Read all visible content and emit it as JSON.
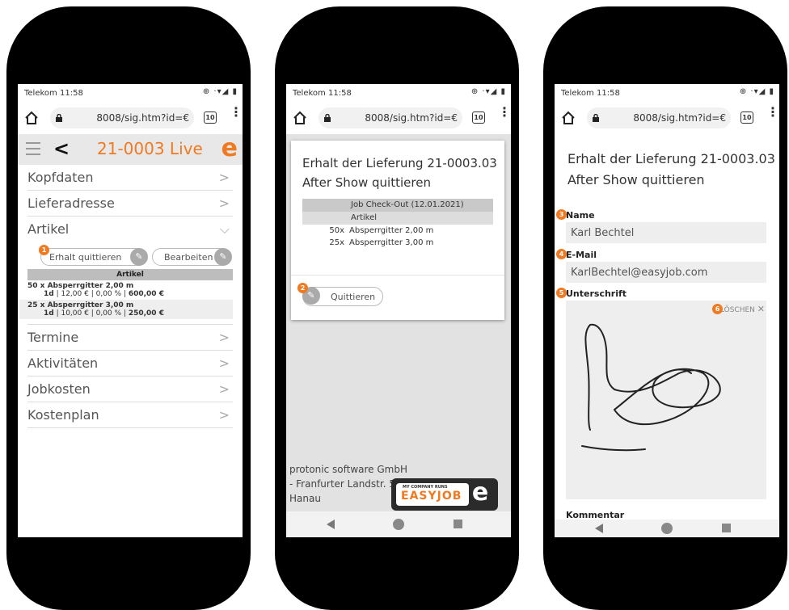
{
  "status": {
    "carrier": "Telekom",
    "time": "11:58",
    "icons": "⊕ ·▾◢ ▮"
  },
  "browser": {
    "url": "8008/sig.htm?id=€",
    "tab_count": "10"
  },
  "phone1": {
    "app_title": "21-0003 Live",
    "logo": "e",
    "sections_top": [
      "Kopfdaten",
      "Lieferadresse"
    ],
    "artikel_section": "Artikel",
    "badge": "1",
    "btn_quittieren": "Erhalt quittieren",
    "btn_bearbeiten": "Bearbeiten",
    "artikel_header": "Artikel",
    "items": [
      {
        "name": "50 x Absperrgitter 2,00 m",
        "detail_1": "1d",
        "detail_2": "12,00 €",
        "detail_3": "0,00 %",
        "total": "600,00 €"
      },
      {
        "name": "25 x Absperrgitter 3,00 m",
        "detail_1": "1d",
        "detail_2": "10,00 €",
        "detail_3": "0,00 %",
        "total": "250,00 €"
      }
    ],
    "sections_bottom": [
      "Termine",
      "Aktivitäten",
      "Jobkosten",
      "Kostenplan"
    ]
  },
  "phone2": {
    "title_line1": "Erhalt der Lieferung 21-0003.03",
    "title_line2": "After Show quittieren",
    "table_header": "Job Check-Out (12.01.2021)",
    "table_subheader": "Artikel",
    "rows": [
      {
        "qty": "50x",
        "name": "Absperrgitter 2,00 m"
      },
      {
        "qty": "25x",
        "name": "Absperrgitter 3,00 m"
      }
    ],
    "badge": "2",
    "btn_quittieren": "Quittieren",
    "footer_line1": "protonic software GmbH",
    "footer_line2": "- Franfurter Landstr. 52",
    "footer_line3": "Hanau",
    "logo_small": "MY COMPANY RUNS",
    "logo_brand": "easyjob",
    "logo_letter": "e"
  },
  "phone3": {
    "title_line1": "Erhalt der Lieferung 21-0003.03",
    "title_line2": "After Show quittieren",
    "badge_name": "3",
    "label_name": "Name",
    "value_name": "Karl Bechtel",
    "badge_email": "4",
    "label_email": "E-Mail",
    "value_email": "KarlBechtel@easyjob.com",
    "badge_sig": "5",
    "label_sig": "Unterschrift",
    "badge_clear": "6",
    "clear_label": "LÖSCHEN",
    "label_comment": "Kommentar"
  },
  "colors": {
    "accent": "#f07a21",
    "header_bg": "#e8e8e8",
    "table_grey": "#c9c9c9"
  }
}
